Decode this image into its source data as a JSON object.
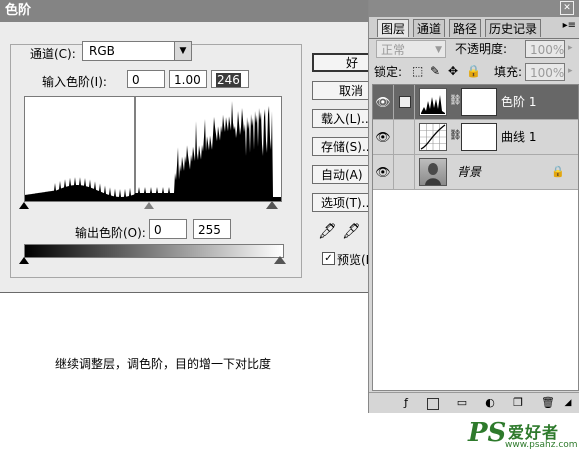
{
  "levels_dialog": {
    "title": "色阶",
    "channel_label": "通道(C):",
    "channel_value": "RGB",
    "input_label": "输入色阶(I):",
    "input_black": "0",
    "input_gamma": "1.00",
    "input_white": "246",
    "output_label": "输出色阶(O):",
    "output_black": "0",
    "output_white": "255",
    "buttons": {
      "ok": "好",
      "cancel": "取消",
      "load": "载入(L)...",
      "save": "存储(S)...",
      "auto": "自动(A)",
      "options": "选项(T)..."
    },
    "preview_label": "预览(P)",
    "preview_checked": true
  },
  "layers_palette": {
    "tabs": [
      "图层",
      "通道",
      "路径",
      "历史记录"
    ],
    "blend_mode": "正常",
    "opacity_label": "不透明度:",
    "opacity_value": "100%",
    "lock_label": "锁定:",
    "fill_label": "填充:",
    "fill_value": "100%",
    "layers": [
      {
        "name": "色阶 1",
        "type": "levels-adjustment",
        "selected": true
      },
      {
        "name": "曲线 1",
        "type": "curves-adjustment",
        "selected": false
      },
      {
        "name": "背景",
        "type": "image",
        "selected": false
      }
    ]
  },
  "caption": "继续调整层，调色阶，目的增一下对比度",
  "watermark": {
    "logo": "PS",
    "name": "爱好者",
    "url": "www.psahz.com"
  },
  "colors": {
    "selected_layer": "#676767",
    "watermark": "#2e7a2c"
  }
}
